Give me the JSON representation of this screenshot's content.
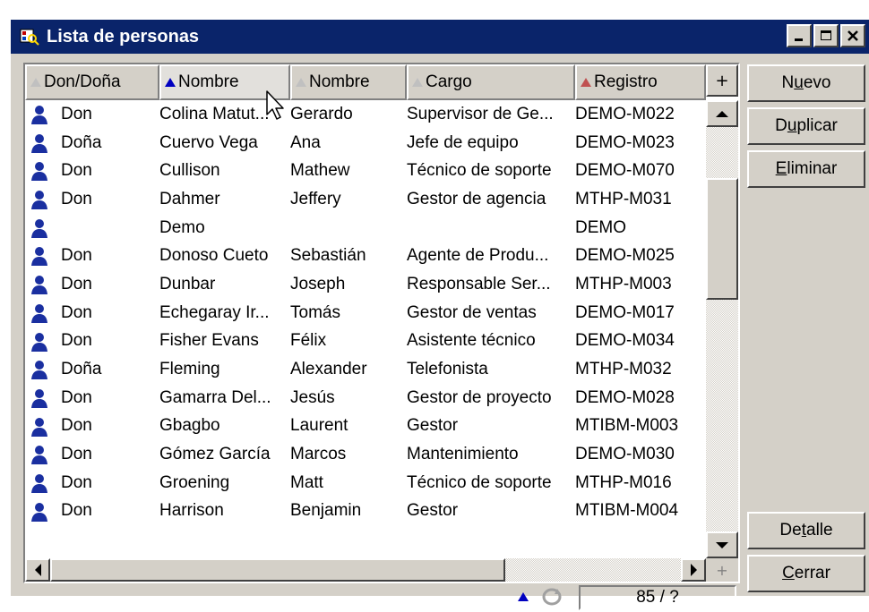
{
  "window": {
    "title": "Lista de personas"
  },
  "columns": [
    {
      "label": "Don/Doña",
      "sort": "none"
    },
    {
      "label": "Nombre",
      "sort": "asc-primary"
    },
    {
      "label": "Nombre",
      "sort": "none"
    },
    {
      "label": "Cargo",
      "sort": "none"
    },
    {
      "label": "Registro",
      "sort": "asc-secondary"
    }
  ],
  "rows": [
    {
      "don": "Don",
      "apellido": "Colina Matut...",
      "nombre": "Gerardo",
      "cargo": "Supervisor de Ge...",
      "registro": "DEMO-M022"
    },
    {
      "don": "Doña",
      "apellido": "Cuervo Vega",
      "nombre": "Ana",
      "cargo": "Jefe de equipo",
      "registro": "DEMO-M023"
    },
    {
      "don": "Don",
      "apellido": "Cullison",
      "nombre": "Mathew",
      "cargo": "Técnico de soporte",
      "registro": "DEMO-M070"
    },
    {
      "don": "Don",
      "apellido": "Dahmer",
      "nombre": "Jeffery",
      "cargo": "Gestor de agencia",
      "registro": "MTHP-M031"
    },
    {
      "don": "",
      "apellido": "Demo",
      "nombre": "",
      "cargo": "",
      "registro": "DEMO"
    },
    {
      "don": "Don",
      "apellido": "Donoso Cueto",
      "nombre": "Sebastián",
      "cargo": "Agente de Produ...",
      "registro": "DEMO-M025"
    },
    {
      "don": "Don",
      "apellido": "Dunbar",
      "nombre": "Joseph",
      "cargo": "Responsable Ser...",
      "registro": "MTHP-M003"
    },
    {
      "don": "Don",
      "apellido": "Echegaray Ir...",
      "nombre": "Tomás",
      "cargo": "Gestor de ventas",
      "registro": "DEMO-M017"
    },
    {
      "don": "Don",
      "apellido": "Fisher Evans",
      "nombre": "Félix",
      "cargo": "Asistente técnico",
      "registro": "DEMO-M034"
    },
    {
      "don": "Doña",
      "apellido": "Fleming",
      "nombre": "Alexander",
      "cargo": "Telefonista",
      "registro": "MTHP-M032"
    },
    {
      "don": "Don",
      "apellido": "Gamarra Del...",
      "nombre": "Jesús",
      "cargo": "Gestor de proyecto",
      "registro": "DEMO-M028"
    },
    {
      "don": "Don",
      "apellido": "Gbagbo",
      "nombre": "Laurent",
      "cargo": "Gestor",
      "registro": "MTIBM-M003"
    },
    {
      "don": "Don",
      "apellido": "Gómez García",
      "nombre": "Marcos",
      "cargo": "Mantenimiento",
      "registro": "DEMO-M030"
    },
    {
      "don": "Don",
      "apellido": "Groening",
      "nombre": "Matt",
      "cargo": "Técnico de soporte",
      "registro": "MTHP-M016"
    },
    {
      "don": "Don",
      "apellido": "Harrison",
      "nombre": "Benjamin",
      "cargo": "Gestor",
      "registro": "MTIBM-M004"
    }
  ],
  "buttons": {
    "nuevo": {
      "pre": "N",
      "u": "u",
      "post": "evo"
    },
    "duplicar": {
      "pre": "D",
      "u": "u",
      "post": "plicar"
    },
    "eliminar": {
      "pre": "",
      "u": "E",
      "post": "liminar"
    },
    "detalle": {
      "pre": "De",
      "u": "t",
      "post": "alle"
    },
    "cerrar": {
      "pre": "",
      "u": "C",
      "post": "errar"
    }
  },
  "status": {
    "count": "85 / ?"
  },
  "scroll": {
    "vertical_position": 0.18,
    "vertical_thumb_size": 0.3
  },
  "colors": {
    "title_bar": "#0a246a",
    "face": "#d4d0c8",
    "sort_primary": "#0000c0",
    "sort_secondary": "#c05050"
  }
}
